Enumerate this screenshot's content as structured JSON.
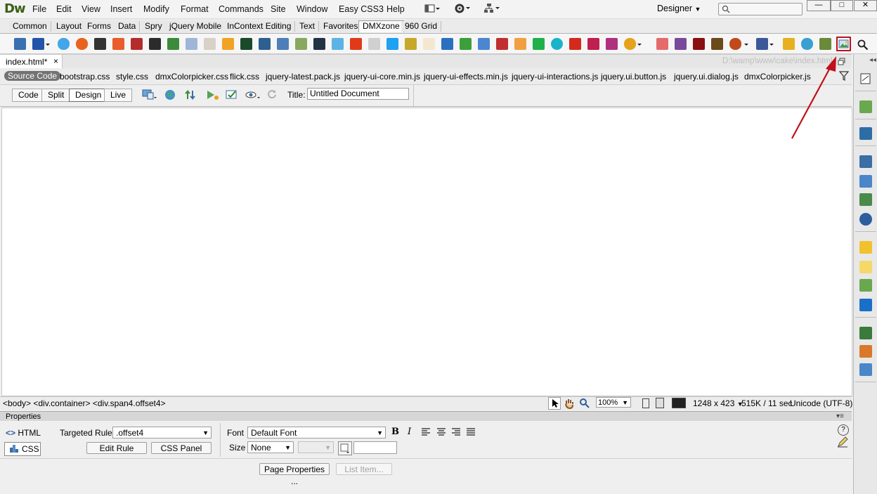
{
  "app": {
    "logo": "Dw",
    "menu": [
      "File",
      "Edit",
      "View",
      "Insert",
      "Modify",
      "Format",
      "Commands",
      "Site",
      "Window",
      "Easy CSS3",
      "Help"
    ],
    "workspace": "Designer",
    "search_placeholder": ""
  },
  "insert_tabs": [
    "Common",
    "Layout",
    "Forms",
    "Data",
    "Spry",
    "jQuery Mobile",
    "InContext Editing",
    "Text",
    "Favorites",
    "DMXzone",
    "960 Grid"
  ],
  "insert_tabs_active": "DMXzone",
  "document": {
    "tab_label": "index.html*",
    "close_glyph": "×",
    "path": "D:\\wamp\\www\\cake\\index.html",
    "source_code_label": "Source Code",
    "related_files": [
      "bootstrap.css",
      "style.css",
      "dmxColorpicker.css",
      "flick.css",
      "jquery-latest.pack.js",
      "jquery-ui-core.min.js",
      "jquery-ui-effects.min.js",
      "jquery-ui-interactions.js",
      "jquery.ui.button.js",
      "jquery.ui.dialog.js",
      "dmxColorpicker.js"
    ]
  },
  "doc_toolbar": {
    "views": [
      "Code",
      "Split",
      "Design",
      "Live"
    ],
    "active_view": "Design",
    "title_label": "Title:",
    "title_value": "Untitled Document"
  },
  "status_bar": {
    "tag_selector": "<body> <div.container> <div.span4.offset4>",
    "zoom": "100%",
    "window_size": "1248 x 423",
    "download": "515K / 11 sec",
    "encoding": "Unicode (UTF-8)"
  },
  "properties": {
    "header": "Properties",
    "html_label": "HTML",
    "css_label": "CSS",
    "targeted_rule_label": "Targeted Rule",
    "targeted_rule_value": ".offset4",
    "edit_rule": "Edit Rule",
    "css_panel": "CSS Panel",
    "font_label": "Font",
    "font_value": "Default Font",
    "size_label": "Size",
    "size_value": "None",
    "bold": "B",
    "italic": "I",
    "page_properties": "Page Properties ...",
    "list_item": "List Item..."
  },
  "colors": {
    "accent_red": "#c0101a",
    "logo_green": "#3b5f13",
    "tag_dark": "#737373"
  }
}
